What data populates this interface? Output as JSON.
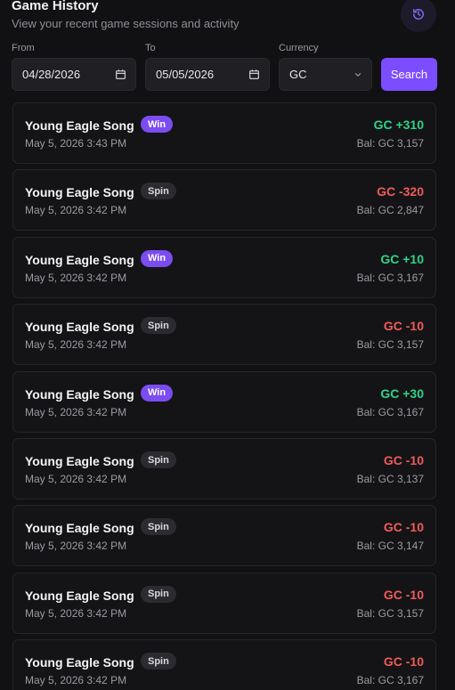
{
  "header": {
    "title": "Game History",
    "subtitle": "View your recent game sessions and activity",
    "history_icon": "history-icon"
  },
  "filters": {
    "from_label": "From",
    "from_value": "04/28/2026",
    "to_label": "To",
    "to_value": "05/05/2026",
    "currency_label": "Currency",
    "currency_value": "GC",
    "search_label": "Search"
  },
  "colors": {
    "accent": "#7c4dff",
    "positive": "#2fd38a",
    "negative": "#f05b5b",
    "background": "#111113"
  },
  "sessions": [
    {
      "game": "Young Eagle Song",
      "badge": "Win",
      "time": "May 5, 2026 3:43 PM",
      "amount": "GC +310",
      "balance": "Bal: GC 3,157",
      "positive": true
    },
    {
      "game": "Young Eagle Song",
      "badge": "Spin",
      "time": "May 5, 2026 3:42 PM",
      "amount": "GC -320",
      "balance": "Bal: GC 2,847",
      "positive": false
    },
    {
      "game": "Young Eagle Song",
      "badge": "Win",
      "time": "May 5, 2026 3:42 PM",
      "amount": "GC +10",
      "balance": "Bal: GC 3,167",
      "positive": true
    },
    {
      "game": "Young Eagle Song",
      "badge": "Spin",
      "time": "May 5, 2026 3:42 PM",
      "amount": "GC -10",
      "balance": "Bal: GC 3,157",
      "positive": false
    },
    {
      "game": "Young Eagle Song",
      "badge": "Win",
      "time": "May 5, 2026 3:42 PM",
      "amount": "GC +30",
      "balance": "Bal: GC 3,167",
      "positive": true
    },
    {
      "game": "Young Eagle Song",
      "badge": "Spin",
      "time": "May 5, 2026 3:42 PM",
      "amount": "GC -10",
      "balance": "Bal: GC 3,137",
      "positive": false
    },
    {
      "game": "Young Eagle Song",
      "badge": "Spin",
      "time": "May 5, 2026 3:42 PM",
      "amount": "GC -10",
      "balance": "Bal: GC 3,147",
      "positive": false
    },
    {
      "game": "Young Eagle Song",
      "badge": "Spin",
      "time": "May 5, 2026 3:42 PM",
      "amount": "GC -10",
      "balance": "Bal: GC 3,157",
      "positive": false
    },
    {
      "game": "Young Eagle Song",
      "badge": "Spin",
      "time": "May 5, 2026 3:42 PM",
      "amount": "GC -10",
      "balance": "Bal: GC 3,167",
      "positive": false
    }
  ]
}
